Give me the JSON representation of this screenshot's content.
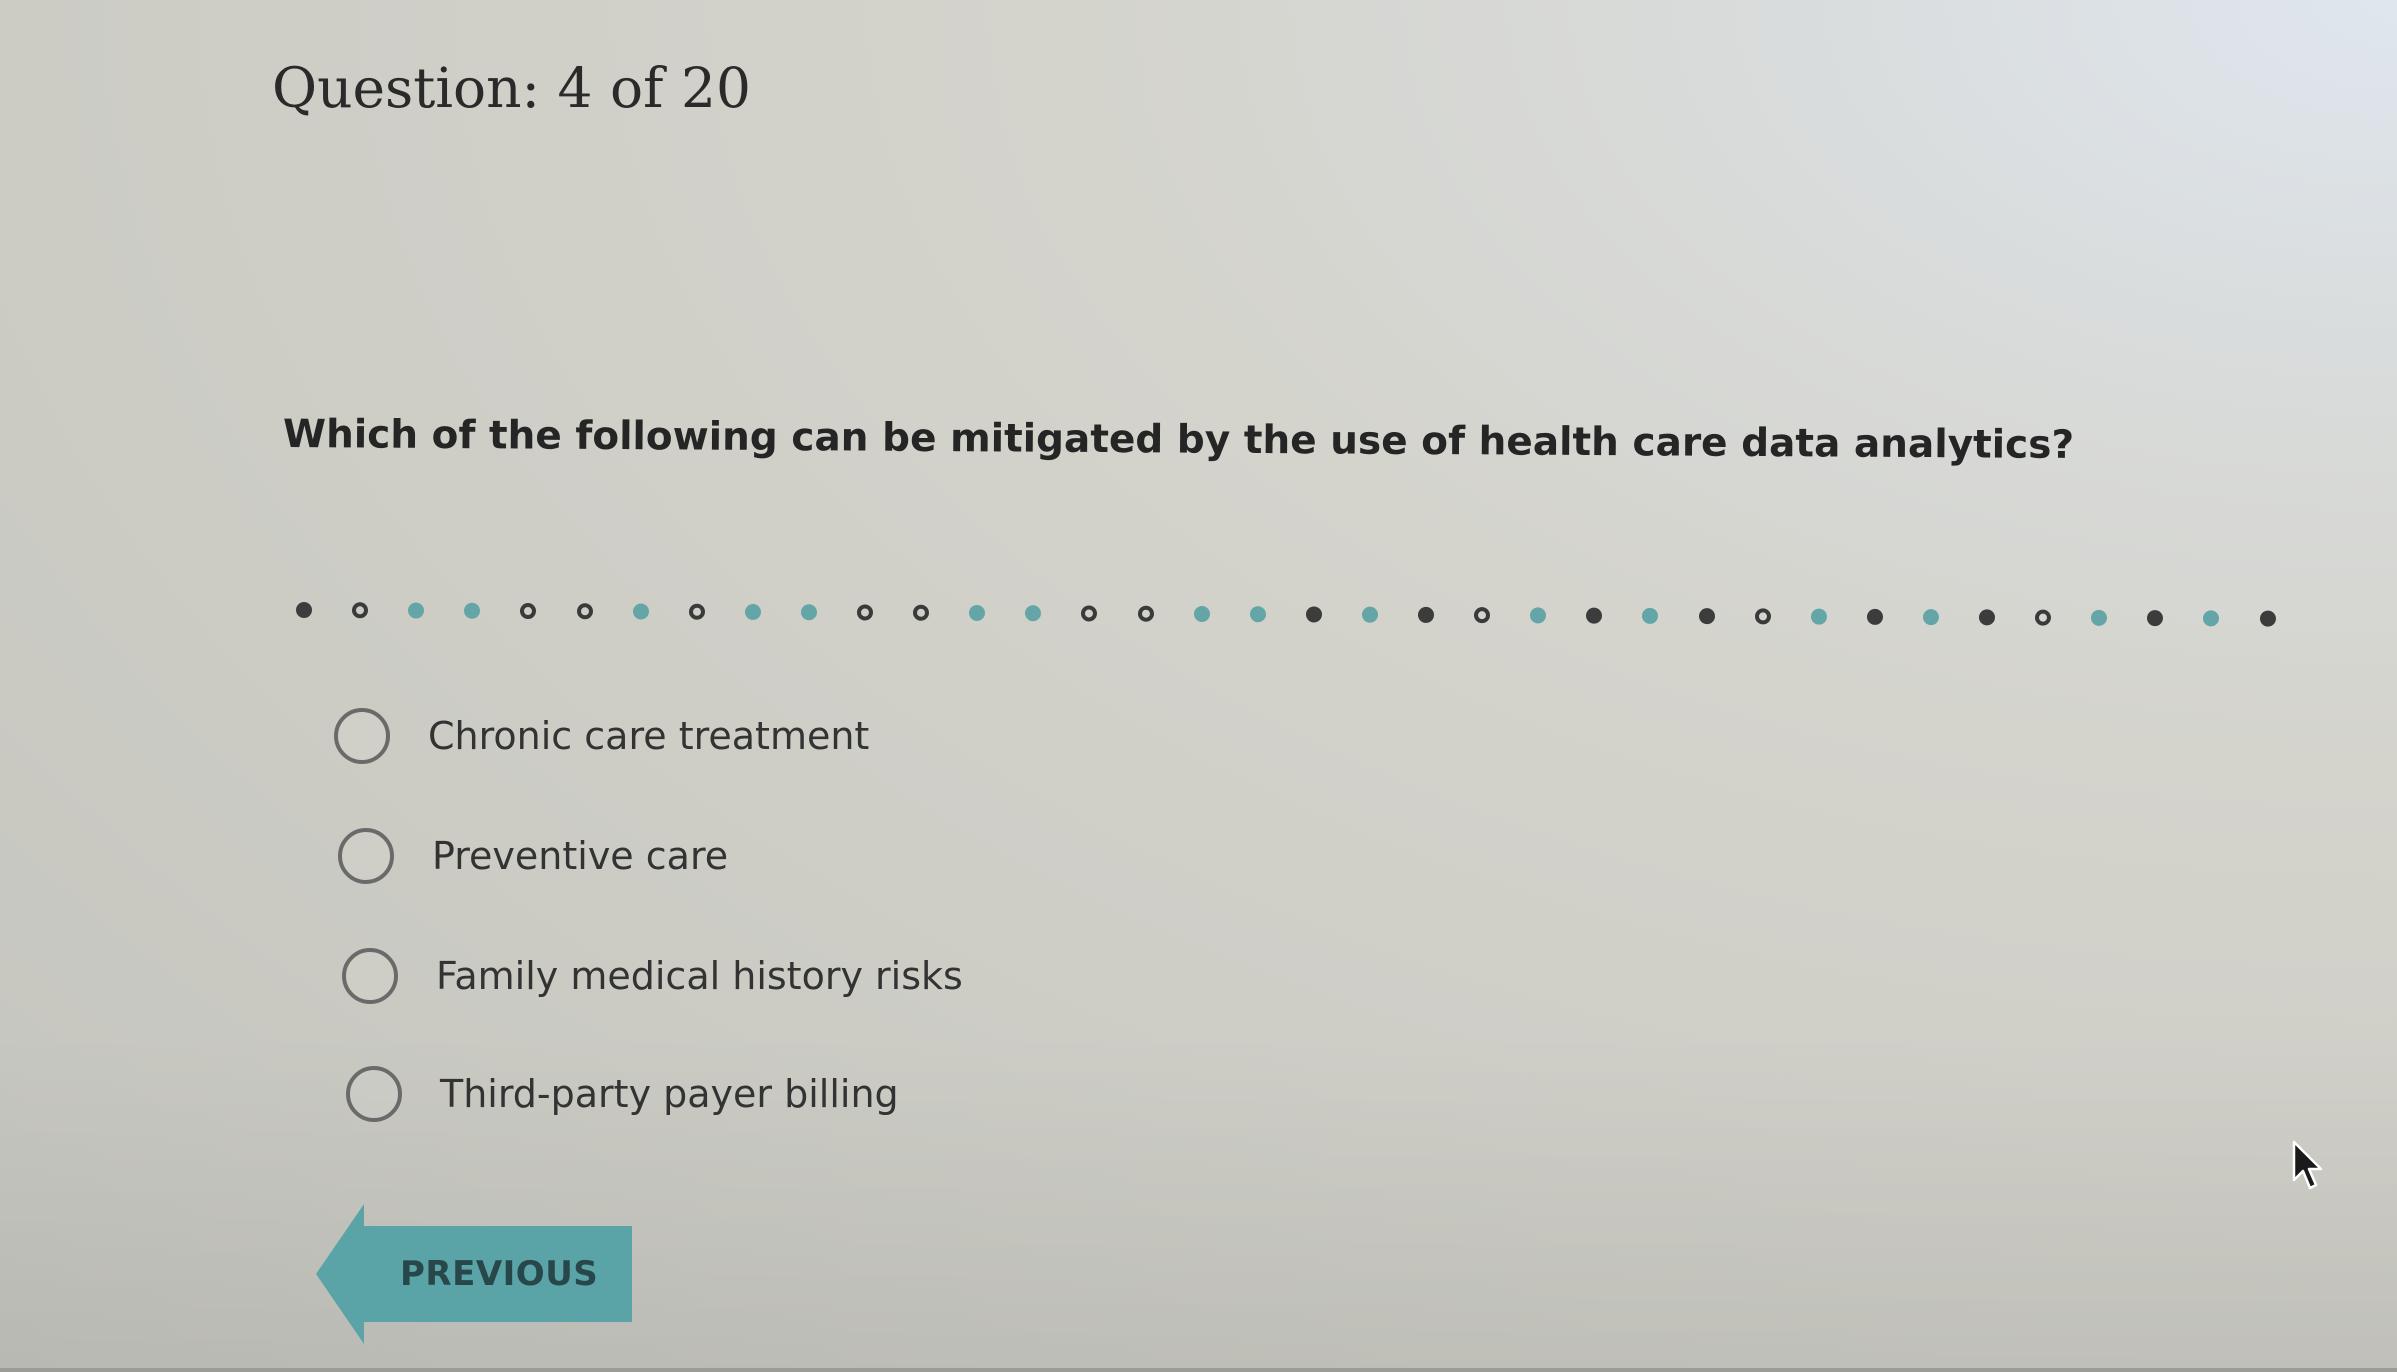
{
  "question_header": "Question: 4 of 20",
  "question_text": "Which of the following can be mitigated by the use of health care data analytics?",
  "progress": {
    "total": 36,
    "states": [
      "answered",
      "unanswered",
      "teal",
      "teal",
      "unanswered",
      "unanswered",
      "teal",
      "unanswered",
      "teal",
      "teal",
      "unanswered",
      "unanswered",
      "teal",
      "teal",
      "unanswered",
      "unanswered",
      "teal",
      "teal",
      "answered",
      "teal",
      "answered",
      "unanswered",
      "teal",
      "answered",
      "teal",
      "answered",
      "unanswered",
      "teal",
      "answered",
      "teal",
      "answered",
      "unanswered",
      "teal",
      "answered",
      "teal",
      "answered"
    ]
  },
  "options": [
    {
      "label": "Chronic care treatment"
    },
    {
      "label": "Preventive care"
    },
    {
      "label": "Family medical history risks"
    },
    {
      "label": "Third-party payer billing"
    }
  ],
  "nav": {
    "previous_label": "PREVIOUS"
  },
  "colors": {
    "accent_teal": "#5fa6a8",
    "text_dark": "#252525"
  },
  "icons": {
    "cursor": "mouse-pointer-icon"
  }
}
